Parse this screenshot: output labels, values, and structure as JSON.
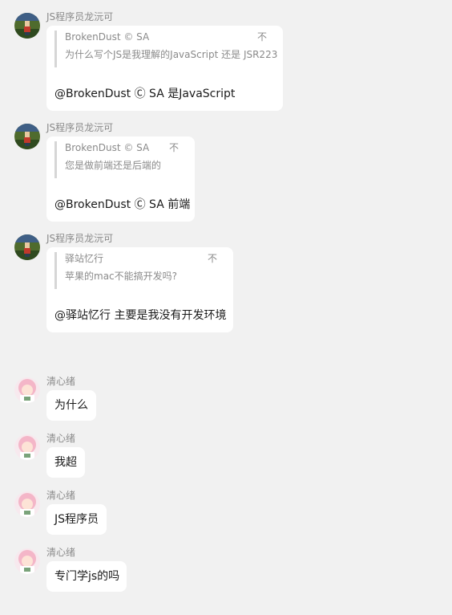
{
  "messages": [
    {
      "sender": "JS程序员龙沅可",
      "quote_author": "BrokenDust © SA",
      "quote_text": "为什么写个JS是我理解的JavaScript 还是 JSR223",
      "quote_jump": "不",
      "text": "@BrokenDust Ⓒ SA 是JavaScript"
    },
    {
      "sender": "JS程序员龙沅可",
      "quote_author": "BrokenDust © SA",
      "quote_text": "您是做前端还是后端的",
      "quote_jump": "不",
      "text": "@BrokenDust Ⓒ SA 前端"
    },
    {
      "sender": "JS程序员龙沅可",
      "quote_author": "驿站忆行",
      "quote_text": "苹果的mac不能搞开发吗?",
      "quote_jump": "不",
      "text": "@驿站忆行 主要是我没有开发环境"
    },
    {
      "sender": "清心绪",
      "text": "为什么"
    },
    {
      "sender": "清心绪",
      "text": "我超"
    },
    {
      "sender": "清心绪",
      "text": "JS程序员"
    },
    {
      "sender": "清心绪",
      "text": "专门学js的吗"
    }
  ]
}
